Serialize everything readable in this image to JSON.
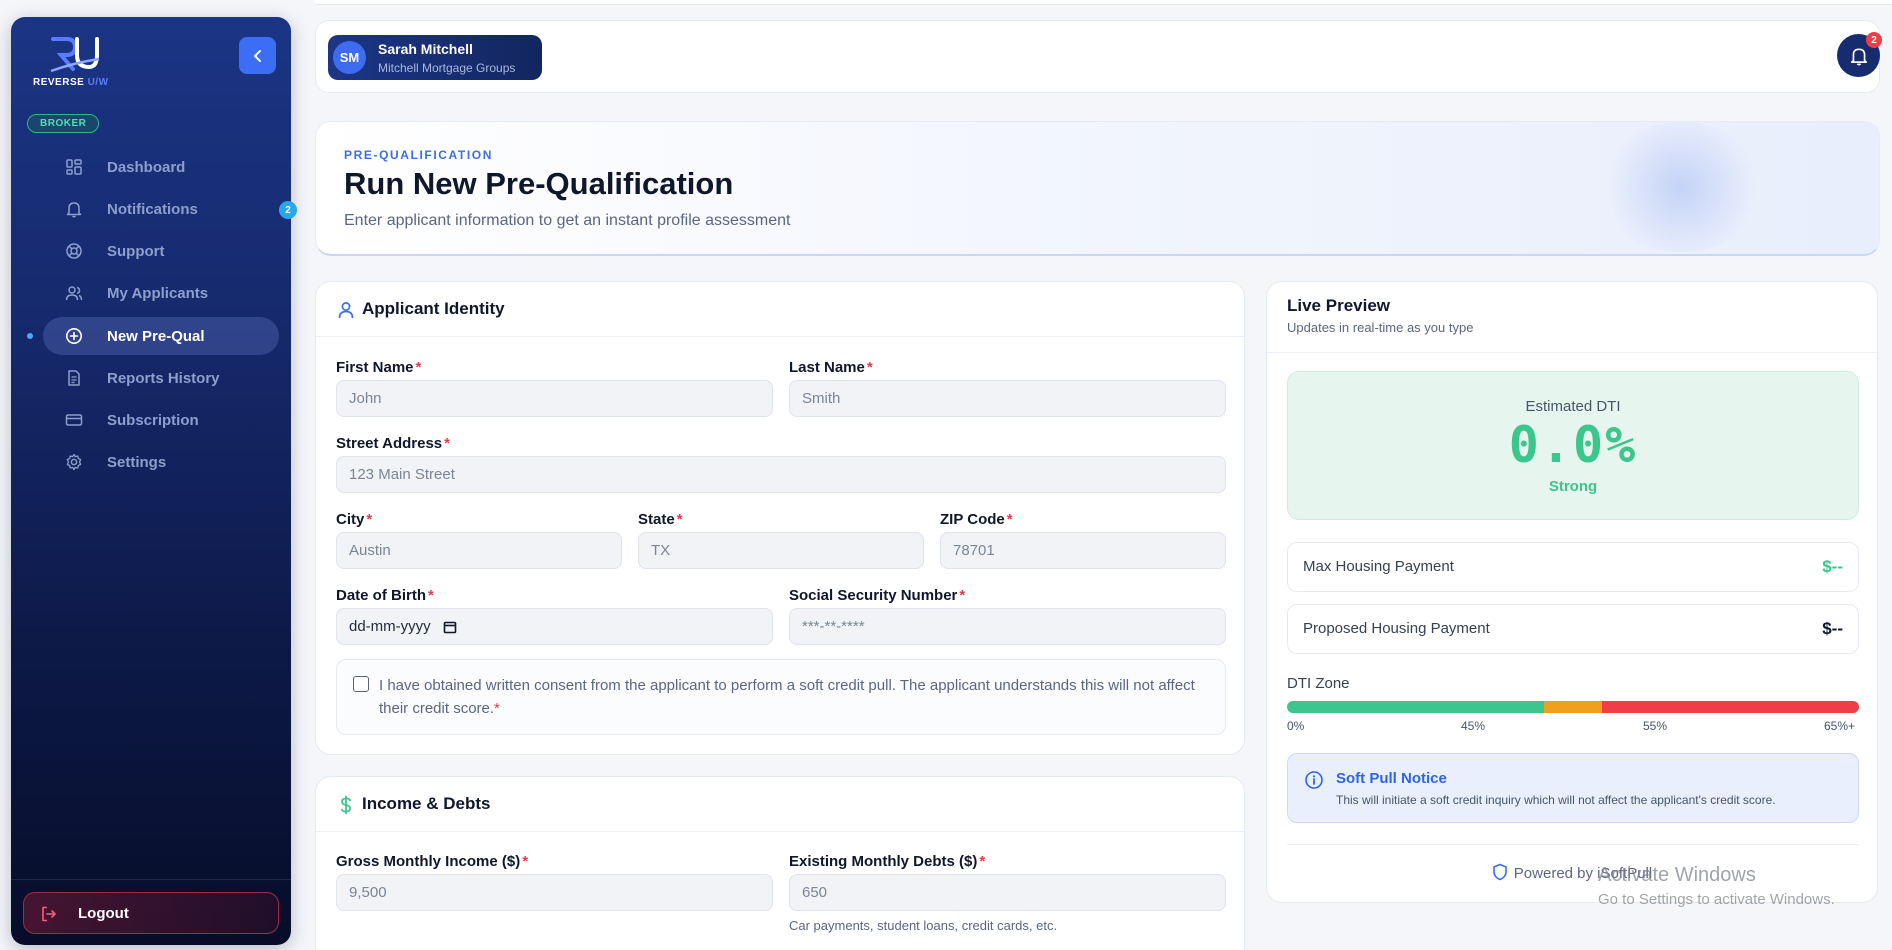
{
  "sidebar": {
    "logo_text": "REVERSE",
    "logo_text_accent": "U/W",
    "role_badge": "BROKER",
    "items": [
      {
        "label": "Dashboard"
      },
      {
        "label": "Notifications",
        "badge": "2"
      },
      {
        "label": "Support"
      },
      {
        "label": "My Applicants"
      },
      {
        "label": "New Pre-Qual",
        "active": true
      },
      {
        "label": "Reports History"
      },
      {
        "label": "Subscription"
      },
      {
        "label": "Settings"
      }
    ],
    "logout_label": "Logout"
  },
  "header": {
    "user_initials": "SM",
    "user_name": "Sarah Mitchell",
    "user_org": "Mitchell Mortgage Groups",
    "notification_count": "2"
  },
  "hero": {
    "eyebrow": "PRE-QUALIFICATION",
    "title": "Run New Pre-Qualification",
    "subtitle": "Enter applicant information to get an instant profile assessment"
  },
  "identity": {
    "title": "Applicant Identity",
    "first_name": {
      "label": "First Name",
      "placeholder": "John"
    },
    "last_name": {
      "label": "Last Name",
      "placeholder": "Smith"
    },
    "street": {
      "label": "Street Address",
      "placeholder": "123 Main Street"
    },
    "city": {
      "label": "City",
      "placeholder": "Austin"
    },
    "state": {
      "label": "State",
      "placeholder": "TX"
    },
    "zip": {
      "label": "ZIP Code",
      "placeholder": "78701"
    },
    "dob": {
      "label": "Date of Birth",
      "value": "dd-mm-yyyy"
    },
    "ssn": {
      "label": "Social Security Number",
      "placeholder": "***-**-****"
    },
    "consent_text": "I have obtained written consent from the applicant to perform a soft credit pull. The applicant understands this will not affect their credit score.",
    "required_mark": "*"
  },
  "income": {
    "title": "Income & Debts",
    "gross_income": {
      "label": "Gross Monthly Income ($)",
      "placeholder": "9,500"
    },
    "debts": {
      "label": "Existing Monthly Debts ($)",
      "placeholder": "650",
      "hint": "Car payments, student loans, credit cards, etc."
    }
  },
  "preview": {
    "title": "Live Preview",
    "subtitle": "Updates in real-time as you type",
    "dti_label": "Estimated DTI",
    "dti_value": "0.0%",
    "dti_status": "Strong",
    "max_housing_label": "Max Housing Payment",
    "max_housing_value": "$--",
    "proposed_housing_label": "Proposed Housing Payment",
    "proposed_housing_value": "$--",
    "zone_title": "DTI Zone",
    "zone_ticks": [
      "0%",
      "45%",
      "55%",
      "65%+"
    ],
    "zone_colors": {
      "green": "#3cc58c",
      "orange": "#f0a01e",
      "red": "#ef3e4a"
    },
    "notice_title": "Soft Pull Notice",
    "notice_text": "This will initiate a soft credit inquiry which will not affect the applicant's credit score.",
    "powered_by": "Powered by iSoftPull"
  },
  "watermark": {
    "line1": "Activate Windows",
    "line2": "Go to Settings to activate Windows."
  },
  "colors": {
    "accent": "#3b6ef5",
    "sidebar_bg": "#15286a",
    "success": "#3cc58c",
    "danger": "#ef3e4a"
  }
}
